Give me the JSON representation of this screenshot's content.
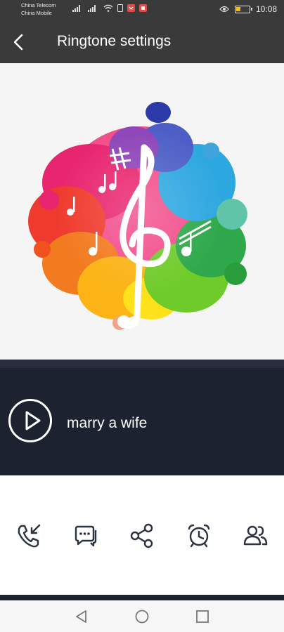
{
  "status_bar": {
    "carrier_1": "China Telecom",
    "carrier_2": "China Mobile",
    "time": "10:08",
    "battery_level": 0.35
  },
  "header": {
    "title": "Ringtone settings",
    "back_icon": "chevron-left-icon"
  },
  "artwork": {
    "icon": "colorful-treble-clef-splash-image"
  },
  "player": {
    "song_title": "marry a wife",
    "play_icon": "play-icon"
  },
  "actions": [
    {
      "icon": "incoming-call-icon"
    },
    {
      "icon": "message-bubble-icon"
    },
    {
      "icon": "share-icon"
    },
    {
      "icon": "alarm-clock-icon"
    },
    {
      "icon": "contacts-icon"
    }
  ],
  "navigation": {
    "back": "nav-back-icon",
    "home": "nav-home-icon",
    "recents": "nav-recents-icon"
  },
  "colors": {
    "header_bg": "#3a3a3a",
    "player_bg": "#1c2230",
    "icon": "#2b3242"
  }
}
